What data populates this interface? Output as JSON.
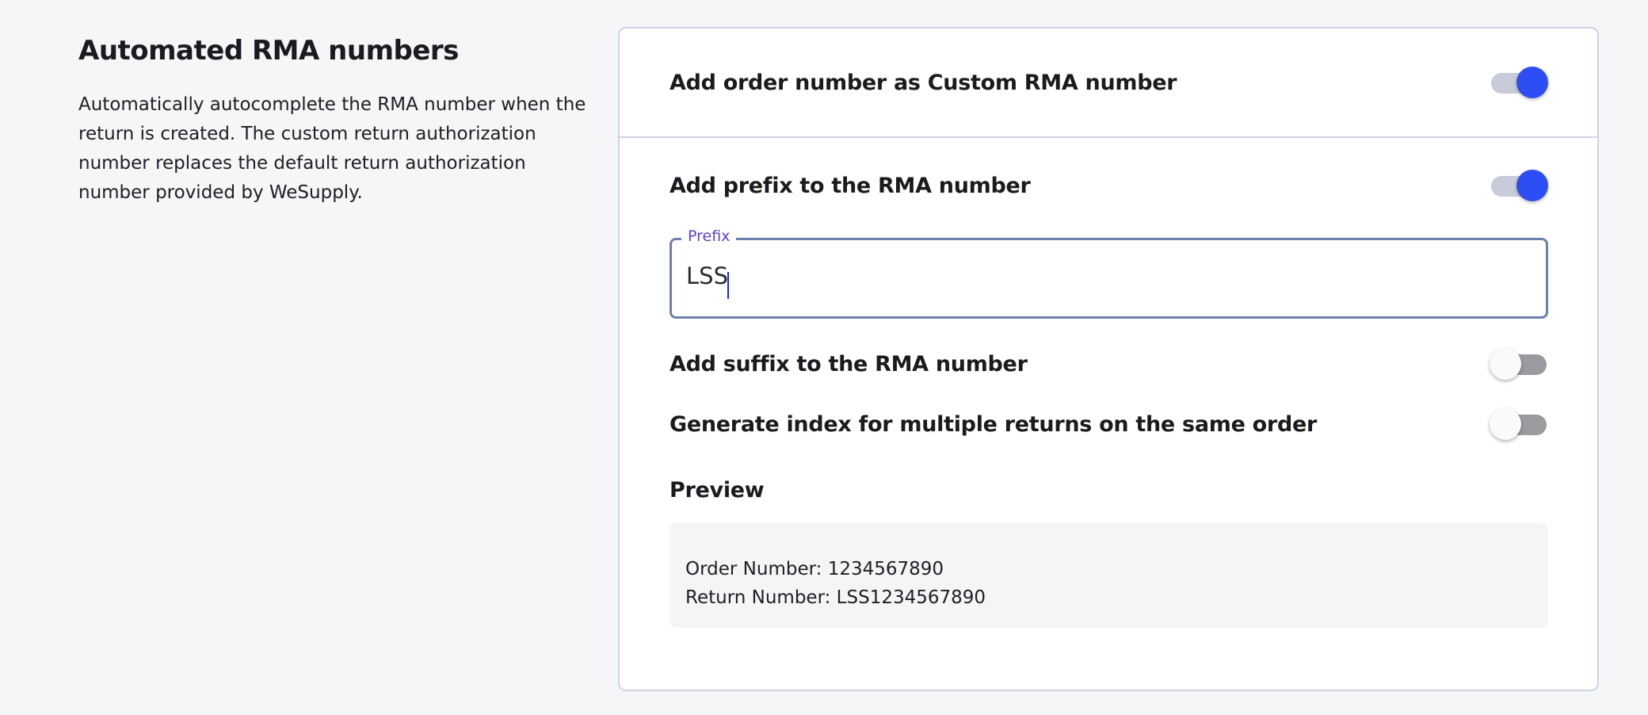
{
  "intro": {
    "title": "Automated RMA numbers",
    "description": "Automatically autocomplete the RMA number when the return is created. The custom return authorization number replaces the default return authorization number provided by WeSupply."
  },
  "settings": {
    "order_number": {
      "label": "Add order number as Custom RMA number",
      "enabled": true
    },
    "prefix": {
      "label": "Add prefix to the RMA number",
      "enabled": true
    },
    "prefix_field": {
      "legend": "Prefix",
      "value": "LSS"
    },
    "suffix": {
      "label": "Add suffix to the RMA number",
      "enabled": false
    },
    "index": {
      "label": "Generate index for multiple returns on the same order",
      "enabled": false
    }
  },
  "preview": {
    "title": "Preview",
    "order_line": "Order Number: 1234567890",
    "return_line": "Return Number: LSS1234567890"
  },
  "colors": {
    "accent": "#2d4ef5",
    "toggle_off": "#9b9b9f",
    "border": "#cfd3e6",
    "legend": "#5b43c8"
  }
}
